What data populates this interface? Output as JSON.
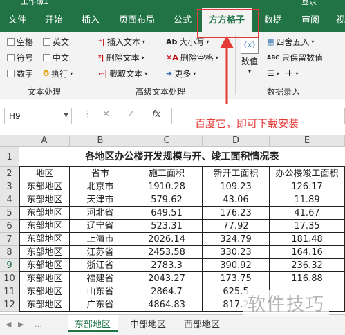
{
  "titlebar": {
    "left_fragment": "工作簿1",
    "right_fragment": "登录"
  },
  "tabs": [
    {
      "label": "文件",
      "key": "file"
    },
    {
      "label": "开始",
      "key": "home"
    },
    {
      "label": "插入",
      "key": "insert"
    },
    {
      "label": "页面布局",
      "key": "layout"
    },
    {
      "label": "公式",
      "key": "formulas"
    },
    {
      "label": "方方格子",
      "key": "ffgz",
      "active": true
    },
    {
      "label": "数据",
      "key": "data"
    },
    {
      "label": "审阅",
      "key": "review"
    },
    {
      "label": "视",
      "key": "view"
    }
  ],
  "ribbon": {
    "text_group": {
      "checks": [
        "空格",
        "英文",
        "符号",
        "中文",
        "数字"
      ],
      "execute": "执行",
      "label": "文本处理"
    },
    "advanced_group": {
      "insert_text": "插入文本",
      "delete_text": "删除文本",
      "extract_text": "截取文本",
      "font_size": "大小写",
      "delete_space": "删除空格",
      "more": "更多",
      "label": "高级文本处理"
    },
    "data_group": {
      "numeric": "数值",
      "round": "四舍五入",
      "keep_numbers": "只保留数值",
      "label": "数据录入"
    }
  },
  "annotation": {
    "note": "百度它，即可下载安装"
  },
  "formula_bar": {
    "name_box": "H9",
    "fx": "fx",
    "cancel": "✕",
    "confirm": "✓"
  },
  "sheet": {
    "columns": [
      "A",
      "B",
      "C",
      "D",
      "E"
    ],
    "rows": [
      "1",
      "2",
      "3",
      "4",
      "5",
      "6",
      "7",
      "8",
      "9",
      "10",
      "11",
      "12"
    ],
    "selected_row": "9",
    "title": "各地区办公楼开发规模与开、竣工面积情况表",
    "headers": [
      "地区",
      "省市",
      "施工面积",
      "新开工面积",
      "办公楼竣工面积"
    ],
    "data": [
      [
        "东部地区",
        "北京市",
        "1910.28",
        "109.23",
        "126.17"
      ],
      [
        "东部地区",
        "天津市",
        "579.62",
        "43.06",
        "11.89"
      ],
      [
        "东部地区",
        "河北省",
        "649.51",
        "176.23",
        "41.67"
      ],
      [
        "东部地区",
        "辽宁省",
        "523.31",
        "77.92",
        "17.35"
      ],
      [
        "东部地区",
        "上海市",
        "2026.14",
        "324.79",
        "181.48"
      ],
      [
        "东部地区",
        "江苏省",
        "2453.58",
        "330.23",
        "164.16"
      ],
      [
        "东部地区",
        "浙江省",
        "2783.3",
        "390.92",
        "236.32"
      ],
      [
        "东部地区",
        "福建省",
        "2043.27",
        "173.75",
        "116.88"
      ],
      [
        "东部地区",
        "山东省",
        "2864.7",
        "625.5",
        ""
      ],
      [
        "东部地区",
        "广东省",
        "4864.83",
        "817.2",
        ""
      ]
    ]
  },
  "sheet_tabs": [
    {
      "label": "东部地区",
      "active": true
    },
    {
      "label": "中部地区"
    },
    {
      "label": "西部地区"
    }
  ],
  "watermark": "软件技巧"
}
